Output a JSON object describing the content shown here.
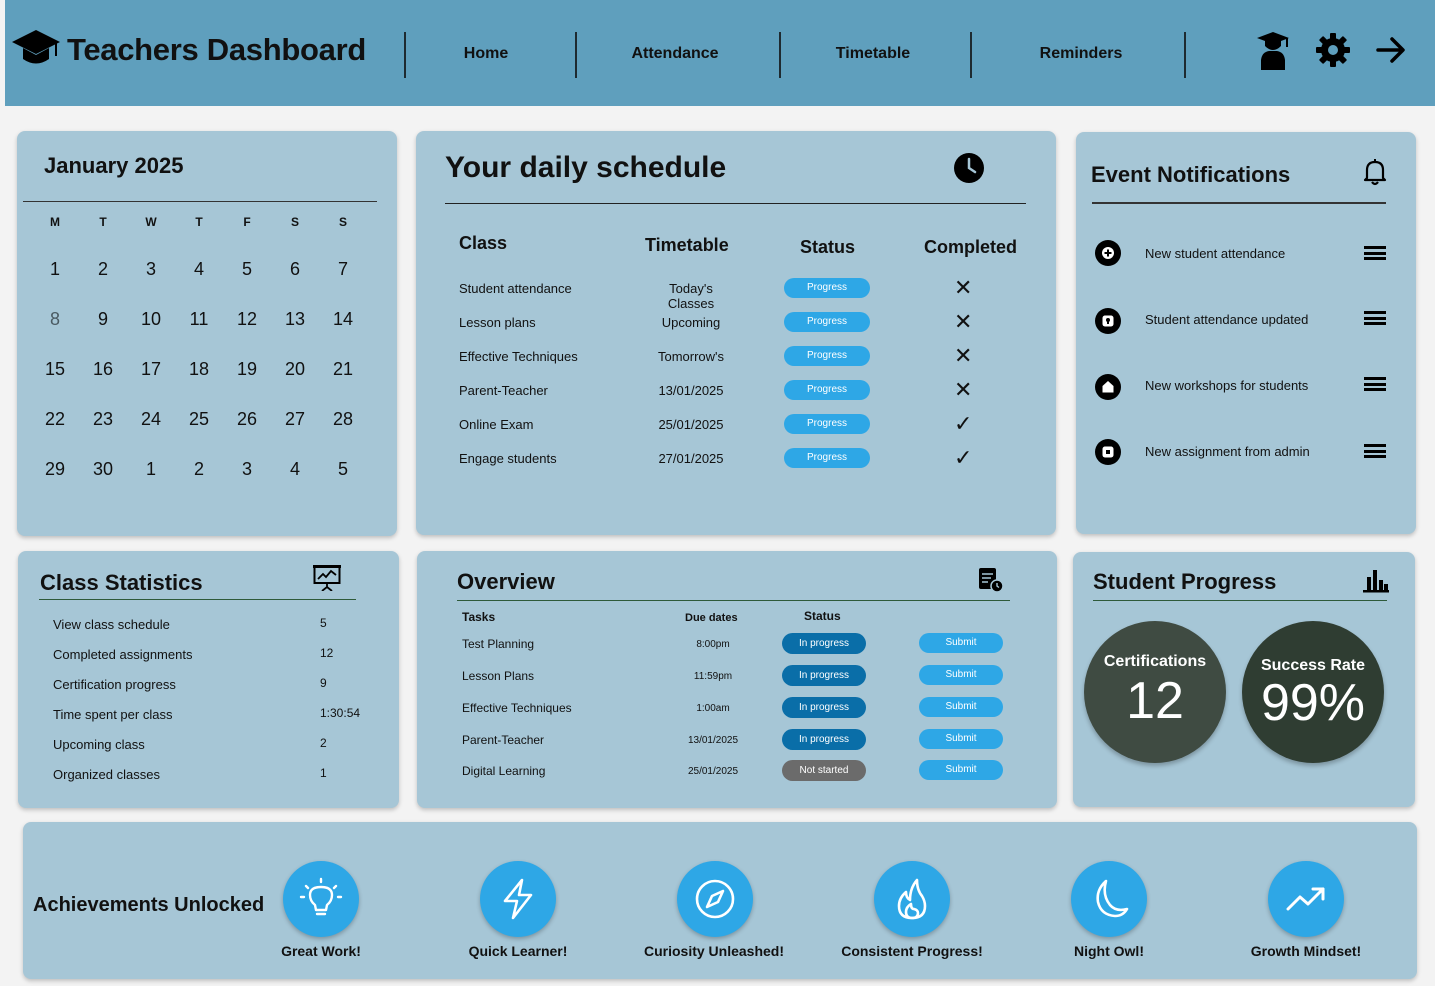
{
  "header": {
    "title": "Teachers Dashboard",
    "nav": [
      "Home",
      "Attendance",
      "Timetable",
      "Reminders"
    ],
    "icons": [
      "graduation-cap-icon",
      "teacher-icon",
      "gear-icon",
      "arrow-right-icon"
    ]
  },
  "calendar": {
    "month": "January 2025",
    "weekdays": [
      "M",
      "T",
      "W",
      "T",
      "F",
      "S",
      "S"
    ],
    "days": [
      "1",
      "2",
      "3",
      "4",
      "5",
      "6",
      "7",
      "8",
      "9",
      "10",
      "11",
      "12",
      "13",
      "14",
      "15",
      "16",
      "17",
      "18",
      "19",
      "20",
      "21",
      "22",
      "23",
      "24",
      "25",
      "26",
      "27",
      "28",
      "29",
      "30",
      "1",
      "2",
      "3",
      "4",
      "5"
    ]
  },
  "schedule": {
    "title": "Your daily schedule",
    "icon": "clock-icon",
    "headers": {
      "class": "Class",
      "timetable": "Timetable",
      "status": "Status",
      "completed": "Completed"
    },
    "rows": [
      {
        "cls": "Student attendance",
        "time": "Today's Classes",
        "status": "Progress",
        "done": false
      },
      {
        "cls": "Lesson plans",
        "time": "Upcoming",
        "status": "Progress",
        "done": false
      },
      {
        "cls": "Effective  Techniques",
        "time": "Tomorrow's",
        "status": "Progress",
        "done": false
      },
      {
        "cls": "Parent-Teacher",
        "time": "13/01/2025",
        "status": "Progress",
        "done": false
      },
      {
        "cls": "Online Exam",
        "time": "25/01/2025",
        "status": "Progress",
        "done": true
      },
      {
        "cls": "Engage students",
        "time": "27/01/2025",
        "status": "Progress",
        "done": true
      }
    ],
    "marks": {
      "done": "✓",
      "not_done": "✕"
    }
  },
  "notifications": {
    "title": "Event Notifications",
    "icon": "bell-icon",
    "items": [
      {
        "text": "New student attendance",
        "icon": "plus-circle-icon"
      },
      {
        "text": "Student attendance updated",
        "icon": "lock-circle-icon"
      },
      {
        "text": "New workshops for students",
        "icon": "home-circle-icon"
      },
      {
        "text": "New assignment from admin",
        "icon": "stop-circle-icon"
      }
    ]
  },
  "stats": {
    "title": "Class Statistics",
    "icon": "presentation-chart-icon",
    "rows": [
      {
        "label": "View class schedule",
        "value": "5"
      },
      {
        "label": "Completed assignments",
        "value": "12"
      },
      {
        "label": "Certification progress",
        "value": "9"
      },
      {
        "label": "Time spent per class",
        "value": "1:30:54"
      },
      {
        "label": "Upcoming class",
        "value": "2"
      },
      {
        "label": "Organized classes",
        "value": "1"
      }
    ]
  },
  "overview": {
    "title": "Overview",
    "icon": "document-clock-icon",
    "headers": {
      "tasks": "Tasks",
      "due": "Due dates",
      "status": "Status"
    },
    "rows": [
      {
        "task": "Test Planning",
        "due": "8:00pm",
        "status": "In progress",
        "action": "Submit"
      },
      {
        "task": "Lesson Plans",
        "due": "11:59pm",
        "status": "In progress",
        "action": "Submit"
      },
      {
        "task": "Effective  Techniques",
        "due": "1:00am",
        "status": "In progress",
        "action": "Submit"
      },
      {
        "task": "Parent-Teacher",
        "due": "13/01/2025",
        "status": "In progress",
        "action": "Submit"
      },
      {
        "task": "Digital Learning",
        "due": "25/01/2025",
        "status": "Not started",
        "action": "Submit"
      }
    ]
  },
  "progress": {
    "title": "Student Progress",
    "icon": "bar-chart-icon",
    "certifications": {
      "label": "Certifications",
      "value": "12"
    },
    "success": {
      "label": "Success Rate",
      "value": "99%"
    }
  },
  "achievements": {
    "title": "Achievements Unlocked",
    "items": [
      {
        "label": "Great Work!",
        "icon": "lightbulb-icon"
      },
      {
        "label": "Quick Learner!",
        "icon": "lightning-icon"
      },
      {
        "label": "Curiosity Unleashed!",
        "icon": "compass-icon"
      },
      {
        "label": "Consistent Progress!",
        "icon": "flame-icon"
      },
      {
        "label": "Night Owl!",
        "icon": "moon-icon"
      },
      {
        "label": "Growth Mindset!",
        "icon": "trending-up-icon"
      }
    ]
  },
  "colors": {
    "header": "#5f9fbd",
    "card": "#a6c6d6",
    "accent": "#2ea7e6",
    "in_progress": "#0a6ea8",
    "not_started": "#6b6b6b",
    "circle_cert": "#3f4b42",
    "circle_success": "#2f3d32"
  }
}
